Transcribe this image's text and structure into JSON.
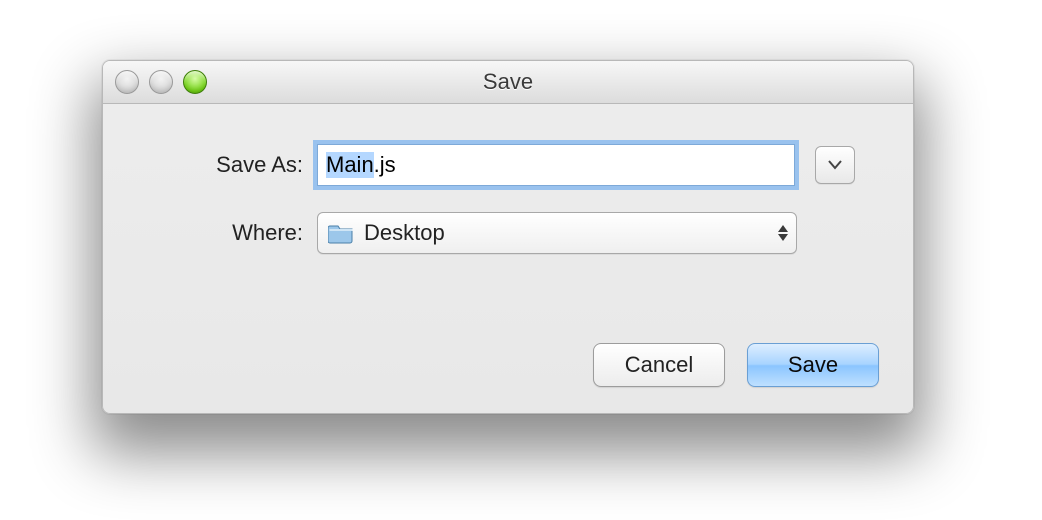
{
  "dialog": {
    "title": "Save",
    "save_as_label": "Save As:",
    "where_label": "Where:",
    "filename_value": "Main.js",
    "location_selected": "Desktop",
    "buttons": {
      "cancel": "Cancel",
      "save": "Save"
    }
  }
}
